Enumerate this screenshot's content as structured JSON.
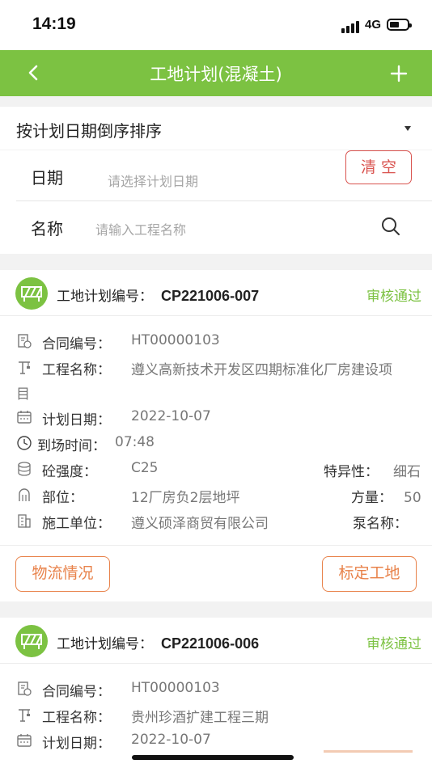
{
  "status_bar": {
    "time": "14:19",
    "network": "4G"
  },
  "nav": {
    "title": "工地计划(混凝土)",
    "back_icon": "chevron-left-icon",
    "add_icon": "plus-icon"
  },
  "sort": {
    "label": "按计划日期倒序排序"
  },
  "filters": {
    "date_label": "日期",
    "date_placeholder": "请选择计划日期",
    "clear_label": "清空",
    "name_label": "名称",
    "name_placeholder": "请输入工程名称"
  },
  "colors": {
    "brand_green": "#7cc242",
    "status_green": "#7cc242",
    "clear_red": "#d9534f",
    "action_orange": "#e8824a"
  },
  "cards": [
    {
      "plan_label": "工地计划编号：",
      "plan_code": "CP221006-007",
      "status": "审核通过",
      "contract_label": "合同编号：",
      "contract_value": "HT00000103",
      "project_label": "工程名称：",
      "project_value_line1": "遵义高新技术开发区四期标准化厂房建设项",
      "project_value_line2": "目",
      "plan_date_label": "计划日期：",
      "plan_date_value": "2022-10-07",
      "arrival_label": "到场时间：",
      "arrival_value": "07:48",
      "strength_label": "砼强度：",
      "strength_value": "C25",
      "special_label": "特异性：",
      "special_value": "细石",
      "position_label": "部位：",
      "position_value": "12厂房负2层地坪",
      "volume_label": "方量：",
      "volume_value": "50",
      "builder_label": "施工单位：",
      "builder_value": "遵义硕泽商贸有限公司",
      "pump_label": "泵名称：",
      "pump_value": "",
      "logistics_button": "物流情况",
      "mark_button": "标定工地"
    },
    {
      "plan_label": "工地计划编号：",
      "plan_code": "CP221006-006",
      "status": "审核通过",
      "contract_label": "合同编号：",
      "contract_value": "HT00000103",
      "project_label": "工程名称：",
      "project_value_line1": "贵州珍酒扩建工程三期",
      "plan_date_label": "计划日期：",
      "plan_date_value": "2022-10-07"
    }
  ]
}
